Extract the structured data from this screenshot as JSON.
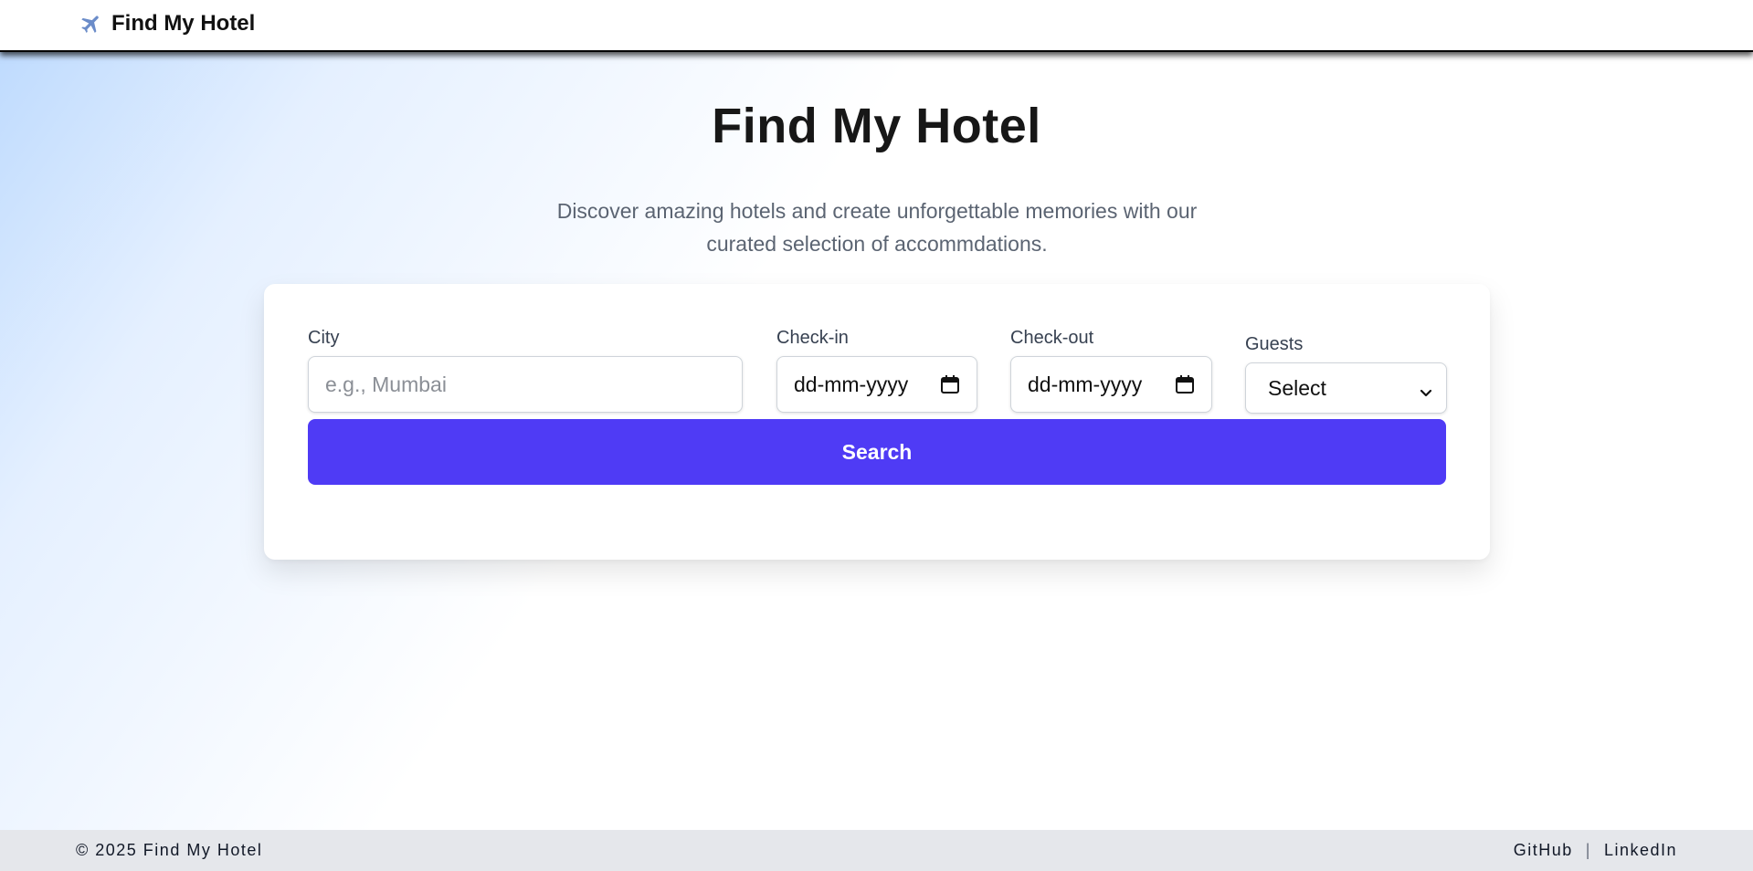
{
  "navbar": {
    "brand": "Find My Hotel",
    "brand_icon": "airplane-icon"
  },
  "hero": {
    "title": "Find My Hotel",
    "subtitle": "Discover amazing hotels and create unforgettable memories with our curated selection of accommdations."
  },
  "search_form": {
    "city": {
      "label": "City",
      "placeholder": "e.g., Mumbai",
      "value": ""
    },
    "check_in": {
      "label": "Check-in",
      "value": "dd-mm-yyyy",
      "icon": "calendar-icon"
    },
    "check_out": {
      "label": "Check-out",
      "value": "dd-mm-yyyy",
      "icon": "calendar-icon"
    },
    "guests": {
      "label": "Guests",
      "selected": "Select",
      "icon": "chevron-down-icon"
    },
    "search_label": "Search"
  },
  "footer": {
    "copyright": "© 2025 Find My Hotel",
    "links": [
      "GitHub",
      "LinkedIn"
    ],
    "separator": "|"
  },
  "colors": {
    "accent": "#4f3bf5",
    "footer_bg": "#e5e7eb",
    "hero_gradient_start": "#bfdbfe"
  }
}
